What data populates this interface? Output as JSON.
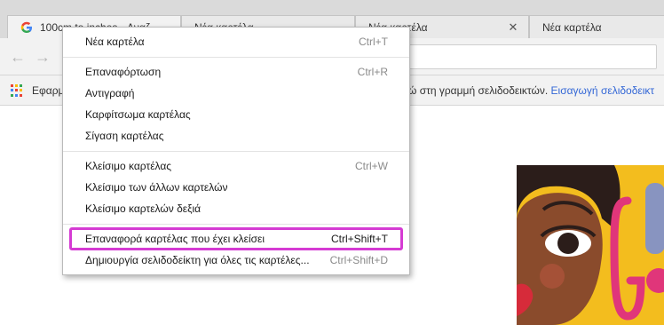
{
  "tabs": [
    {
      "title": "100cm to inches - Αναζ",
      "active": true,
      "has_favicon": true
    },
    {
      "title": "Νέα καρτέλα",
      "active": false,
      "has_favicon": false
    },
    {
      "title": "Νέα καρτέλα",
      "active": false,
      "has_favicon": false
    },
    {
      "title": "Νέα καρτέλα",
      "active": false,
      "has_favicon": false
    }
  ],
  "toolbar": {
    "back_icon": "back-arrow-icon",
    "forward_icon": "forward-arrow-icon"
  },
  "bookmarks_bar": {
    "apps_label": "Εφαρμ",
    "hint_text": "ώ στη γραμμή σελιδοδεικτών.",
    "import_link": "Εισαγωγή σελιδοδεικτ"
  },
  "context_menu": {
    "groups": [
      [
        {
          "label": "Νέα καρτέλα",
          "shortcut": "Ctrl+T"
        }
      ],
      [
        {
          "label": "Επαναφόρτωση",
          "shortcut": "Ctrl+R"
        },
        {
          "label": "Αντιγραφή",
          "shortcut": ""
        },
        {
          "label": "Καρφίτσωμα καρτέλας",
          "shortcut": ""
        },
        {
          "label": "Σίγαση καρτέλας",
          "shortcut": ""
        }
      ],
      [
        {
          "label": "Κλείσιμο καρτέλας",
          "shortcut": "Ctrl+W"
        },
        {
          "label": "Κλείσιμο των άλλων καρτελών",
          "shortcut": ""
        },
        {
          "label": "Κλείσιμο καρτελών δεξιά",
          "shortcut": ""
        }
      ],
      [
        {
          "label": "Επαναφορά καρτέλας που έχει κλείσει",
          "shortcut": "Ctrl+Shift+T",
          "highlighted": true
        },
        {
          "label": "Δημιουργία σελιδοδείκτη για όλες τις καρτέλες...",
          "shortcut": "Ctrl+Shift+D"
        }
      ]
    ]
  },
  "colors": {
    "highlight": "#d53bd3",
    "link": "#3367d6",
    "doodle_bg": "#f3bd1e"
  }
}
